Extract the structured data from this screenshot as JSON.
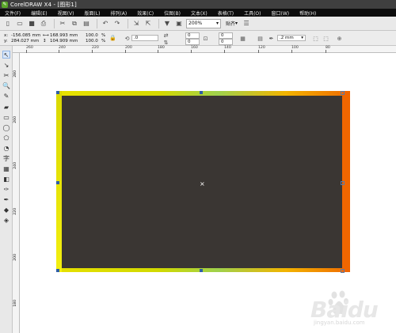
{
  "titlebar": {
    "app_title": "CorelDRAW X4 - [图形1]"
  },
  "menubar": {
    "items": [
      "文件(F)",
      "编辑(E)",
      "视图(V)",
      "版面(L)",
      "排列(A)",
      "效果(C)",
      "位图(B)",
      "文本(X)",
      "表格(T)",
      "工具(O)",
      "窗口(W)",
      "帮助(H)"
    ]
  },
  "toolbar": {
    "zoom_value": "200%",
    "snap_label": "贴齐",
    "icons": [
      "new-icon",
      "open-icon",
      "save-icon",
      "print-icon",
      "cut-icon",
      "copy-icon",
      "paste-icon",
      "undo-icon",
      "redo-icon",
      "import-icon",
      "export-icon",
      "app-launcher-icon",
      "welcome-icon"
    ]
  },
  "propbar": {
    "x_label": "x:",
    "x_value": "-156.085 mm",
    "y_label": "y:",
    "y_value": "284.027 mm",
    "w_value": "168.993 mm",
    "h_value": "104.909 mm",
    "scale_x": "100.0",
    "scale_y": "100.0",
    "percent": "%",
    "rotation": ".0",
    "corner_top": "0",
    "corner_bottom": "0",
    "corner_right_top": "0",
    "corner_right_bottom": "0",
    "outline_width": ".2 mm"
  },
  "ruler_h": {
    "ticks": [
      "260",
      "240",
      "220",
      "200",
      "180",
      "160",
      "140",
      "120",
      "100",
      "80"
    ]
  },
  "ruler_v": {
    "ticks": [
      "280",
      "260",
      "240",
      "220",
      "200",
      "180"
    ]
  },
  "watermark": {
    "brand": "Baidu",
    "sub": "jingyan.baidu.com"
  },
  "colors": {
    "rect_fill": "#3a3633",
    "gradient_left": "#d9d800",
    "gradient_mid": "#a9c93a",
    "gradient_right": "#f06600",
    "selection_handle": "#2f5ea5"
  }
}
